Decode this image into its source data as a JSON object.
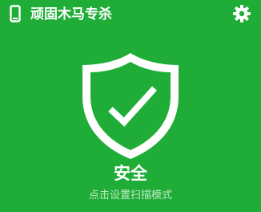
{
  "theme": {
    "background": "#1fad37",
    "foreground": "#ffffff",
    "subtext": "#bfe9c6"
  },
  "header": {
    "device_icon": "phone-icon",
    "title": "顽固木马专杀",
    "settings_icon": "gear-icon"
  },
  "status": {
    "shield_icon": "shield-check-icon",
    "label": "安全",
    "mode_link": "点击设置扫描模式"
  }
}
